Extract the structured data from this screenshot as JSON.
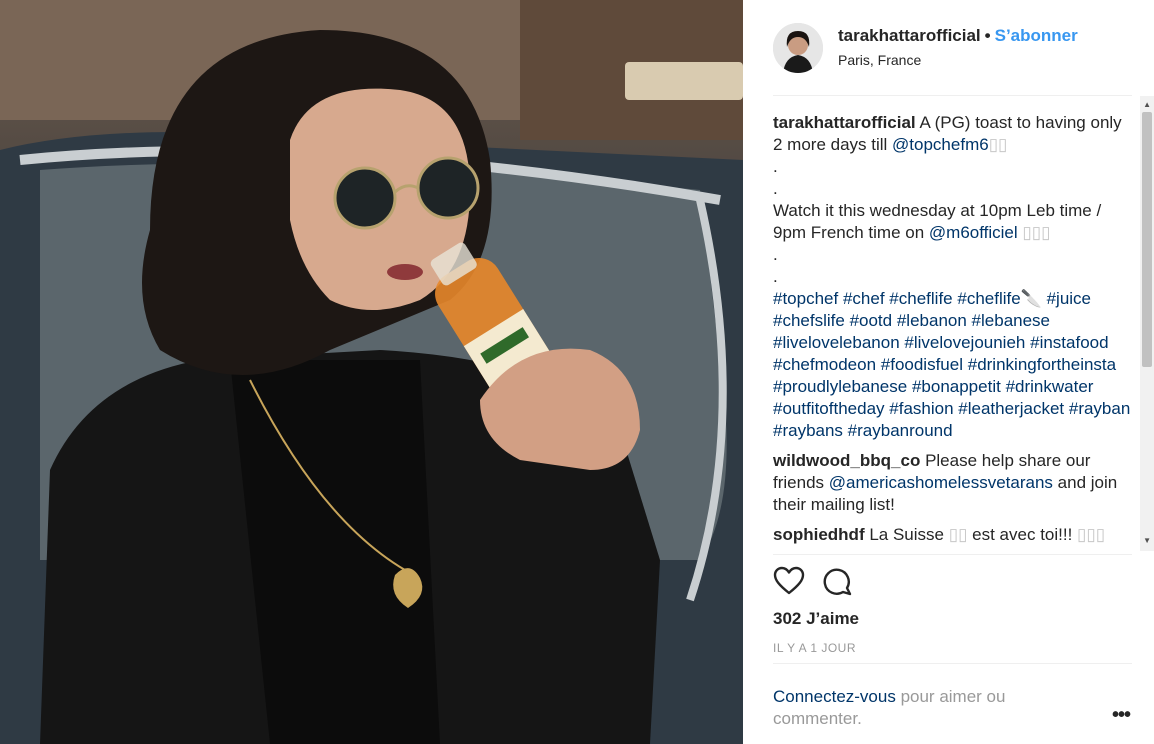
{
  "post": {
    "username": "tarakhattarofficial",
    "separator": "•",
    "follow_label": "S’abonner",
    "location": "Paris, France"
  },
  "caption": {
    "username": "tarakhattarofficial",
    "text_1": " A (PG) toast to having only 2 more days till ",
    "mention_1": "@topchefm6",
    "emoji_1": "▯▯",
    "dot_1": ".",
    "dot_2": ".",
    "text_2": "Watch it this wednesday at 10pm Leb time / 9pm French time on ",
    "mention_2": "@m6officiel",
    "emoji_2": "▯▯▯",
    "dot_3": ".",
    "dot_4": ".",
    "hashtags": [
      "#topchef",
      "#chef",
      "#cheflife",
      "#cheflife🔪",
      "#juice",
      "#chefslife",
      "#ootd",
      "#lebanon",
      "#lebanese",
      "#livelovelebanon",
      "#livelovejounieh",
      "#instafood",
      "#chefmodeon",
      "#foodisfuel",
      "#drinkingfortheinsta",
      "#proudlylebanese",
      "#bonappetit",
      "#drinkwater",
      "#outfitoftheday",
      "#fashion",
      "#leatherjacket",
      "#rayban",
      "#raybans",
      "#raybanround"
    ]
  },
  "comments": [
    {
      "username": "wildwood_bbq_co",
      "text_1": " Please help share our friends ",
      "mention": "@americashomelessvetarans",
      "text_2": " and join their mailing list!"
    },
    {
      "username": "sophiedhdf",
      "text_1": " La Suisse ",
      "faded": "▯▯",
      "text_2": " est avec toi!!! ",
      "faded_2": "▯▯▯"
    }
  ],
  "actions": {
    "like_icon": "heart-outline-icon",
    "comment_icon": "speech-bubble-icon",
    "likes": "302 J’aime",
    "time": "IL Y A 1 JOUR"
  },
  "login": {
    "link": "Connectez-vous",
    "rest": " pour aimer ou commenter."
  },
  "more_label": "•••",
  "colors": {
    "link_blue": "#3897f0",
    "hashtag_navy": "#003569",
    "text": "#262626",
    "muted": "#999999"
  }
}
